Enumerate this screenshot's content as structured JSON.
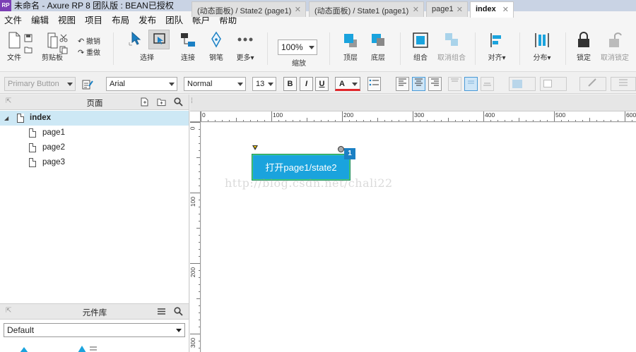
{
  "window": {
    "title": "未命名 - Axure RP 8 团队版 : BEAN已授权",
    "logo": "RP"
  },
  "menu": [
    "文件",
    "编辑",
    "视图",
    "项目",
    "布局",
    "发布",
    "团队",
    "帐户",
    "帮助"
  ],
  "toolbar": {
    "file_label": "文件",
    "clipboard_label": "剪贴板",
    "undo_label": "撤销",
    "redo_label": "重做",
    "select_label": "选择",
    "connect_label": "连接",
    "pen_label": "钢笔",
    "more_label": "更多▾",
    "zoom_value": "100%",
    "zoom_label": "缩放",
    "top_label": "顶层",
    "bottom_label": "底层",
    "group_label": "组合",
    "ungroup_label": "取消组合",
    "align_label": "对齐▾",
    "distribute_label": "分布▾",
    "lock_label": "锁定",
    "unlock_label": "取消锁定"
  },
  "format": {
    "style_value": "Primary Button",
    "font_value": "Arial",
    "weight_value": "Normal",
    "size_value": "13",
    "bold": "B",
    "italic": "I",
    "underline": "U",
    "font_color_letter": "A"
  },
  "pages_panel": {
    "title": "页面",
    "items": [
      {
        "label": "index",
        "selected": true
      },
      {
        "label": "page1"
      },
      {
        "label": "page2"
      },
      {
        "label": "page3"
      }
    ]
  },
  "library_panel": {
    "title": "元件库",
    "selected": "Default"
  },
  "tabs": [
    {
      "label": "(动态面板) / State2 (page1)"
    },
    {
      "label": "(动态面板) / State1 (page1)"
    },
    {
      "label": "page1"
    },
    {
      "label": "index",
      "active": true
    }
  ],
  "ruler": {
    "h_labels": [
      "0",
      "100",
      "200",
      "300",
      "400",
      "500",
      "600"
    ],
    "v_labels": [
      "0",
      "100",
      "200",
      "300"
    ]
  },
  "canvas": {
    "button_text": "打开page1/state2",
    "badge": "1",
    "watermark": "http://blog.csdn.net/chali22"
  },
  "colors": {
    "accent": "#1aa3dd",
    "selection": "#cde8f5",
    "badge": "#1b80c4"
  }
}
